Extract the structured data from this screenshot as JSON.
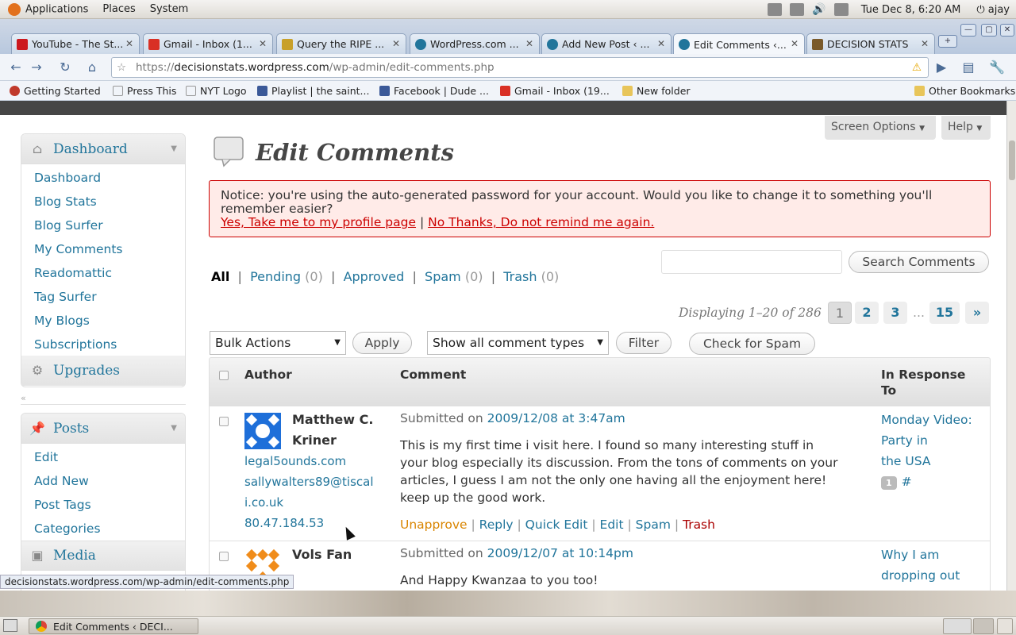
{
  "os": {
    "menus": [
      "Applications",
      "Places",
      "System"
    ],
    "clock": "Tue Dec  8,  6:20 AM",
    "user": "ajay"
  },
  "browser": {
    "tabs": [
      {
        "label": "YouTube - The St...",
        "color": "#cc181e"
      },
      {
        "label": "Gmail - Inbox (1...",
        "color": "#d93025"
      },
      {
        "label": "Query the RIPE ...",
        "color": "#c8a02a"
      },
      {
        "label": "WordPress.com ...",
        "color": "#21759b"
      },
      {
        "label": "Add New Post ‹ ...",
        "color": "#21759b"
      },
      {
        "label": "Edit Comments ‹...",
        "color": "#21759b",
        "active": true
      },
      {
        "label": "DECISION STATS",
        "color": "#7a5a2a"
      }
    ],
    "url_scheme": "https://",
    "url_host": "decisionstats.wordpress.com",
    "url_path": "/wp-admin/edit-comments.php",
    "bookmarks": [
      {
        "label": "Getting Started",
        "color": "#c0392b"
      },
      {
        "label": "Press This",
        "color": "#ffffff"
      },
      {
        "label": "NYT Logo",
        "color": "#ffffff"
      },
      {
        "label": "Playlist | the saint...",
        "color": "#3b5998"
      },
      {
        "label": "Facebook | Dude ...",
        "color": "#3b5998"
      },
      {
        "label": "Gmail - Inbox (19...",
        "color": "#d93025"
      },
      {
        "label": "New folder",
        "color": "#e8c55a"
      }
    ],
    "other_bookmarks": "Other Bookmarks",
    "status_url": "decisionstats.wordpress.com/wp-admin/edit-comments.php"
  },
  "header": {
    "screen_options": "Screen Options",
    "help": "Help",
    "title": "Edit Comments"
  },
  "sidebar": {
    "dashboard_head": "Dashboard",
    "dashboard_items": [
      "Dashboard",
      "Blog Stats",
      "Blog Surfer",
      "My Comments",
      "Readomattic",
      "Tag Surfer",
      "My Blogs",
      "Subscriptions"
    ],
    "upgrades": "Upgrades",
    "posts_head": "Posts",
    "posts_items": [
      "Edit",
      "Add New",
      "Post Tags",
      "Categories"
    ],
    "media": "Media"
  },
  "notice": {
    "text": "Notice: you're using the auto-generated password for your account. Would you like to change it to something you'll remember easier?",
    "yes_link": "Yes, Take me to my profile page",
    "sep": "|",
    "no_link": "No Thanks, Do not remind me again."
  },
  "filters": {
    "all": "All",
    "pending": "Pending",
    "pending_count": "(0)",
    "approved": "Approved",
    "spam": "Spam",
    "spam_count": "(0)",
    "trash": "Trash",
    "trash_count": "(0)"
  },
  "search": {
    "button": "Search Comments",
    "value": ""
  },
  "pagination": {
    "displaying": "Displaying 1–20 of 286",
    "pages": [
      "1",
      "2",
      "3"
    ],
    "ellipsis": "…",
    "last": "15",
    "next": "»"
  },
  "toolbar": {
    "bulk_actions": "Bulk Actions",
    "apply": "Apply",
    "comment_types": "Show all comment types",
    "filter": "Filter",
    "check_spam": "Check for Spam"
  },
  "table": {
    "columns": {
      "author": "Author",
      "comment": "Comment",
      "response_1": "In Response",
      "response_2": "To"
    },
    "rows": [
      {
        "author_lines": [
          "Matthew C.",
          "Kriner"
        ],
        "site": "legal5ounds.com",
        "email_lines": [
          "sallywalters89@tiscal",
          "i.co.uk"
        ],
        "ip": "80.47.184.53",
        "submitted_prefix": "Submitted on",
        "submitted_date": "2009/12/08 at 3:47am",
        "text_lines": [
          "This is my first time i visit here. I found so many interesting stuff in",
          "your blog especially its discussion. From the tons of comments on your",
          "articles, I guess I am not the only one having all the enjoyment here!",
          "keep up the good work."
        ],
        "actions": {
          "unapprove": "Unapprove",
          "reply": "Reply",
          "quick_edit": "Quick Edit",
          "edit": "Edit",
          "spam": "Spam",
          "trash": "Trash"
        },
        "response_lines": [
          "Monday Video:",
          "Party in",
          "the USA"
        ],
        "response_count": "1",
        "response_hash": "#"
      },
      {
        "author_lines": [
          "Vols Fan"
        ],
        "submitted_prefix": "Submitted on",
        "submitted_date": "2009/12/07 at 10:14pm",
        "text_lines": [
          "And Happy Kwanzaa to you too!"
        ],
        "response_lines": [
          "Why I am",
          "dropping out"
        ]
      }
    ]
  },
  "taskbar": {
    "window": "Edit Comments ‹ DECI..."
  }
}
